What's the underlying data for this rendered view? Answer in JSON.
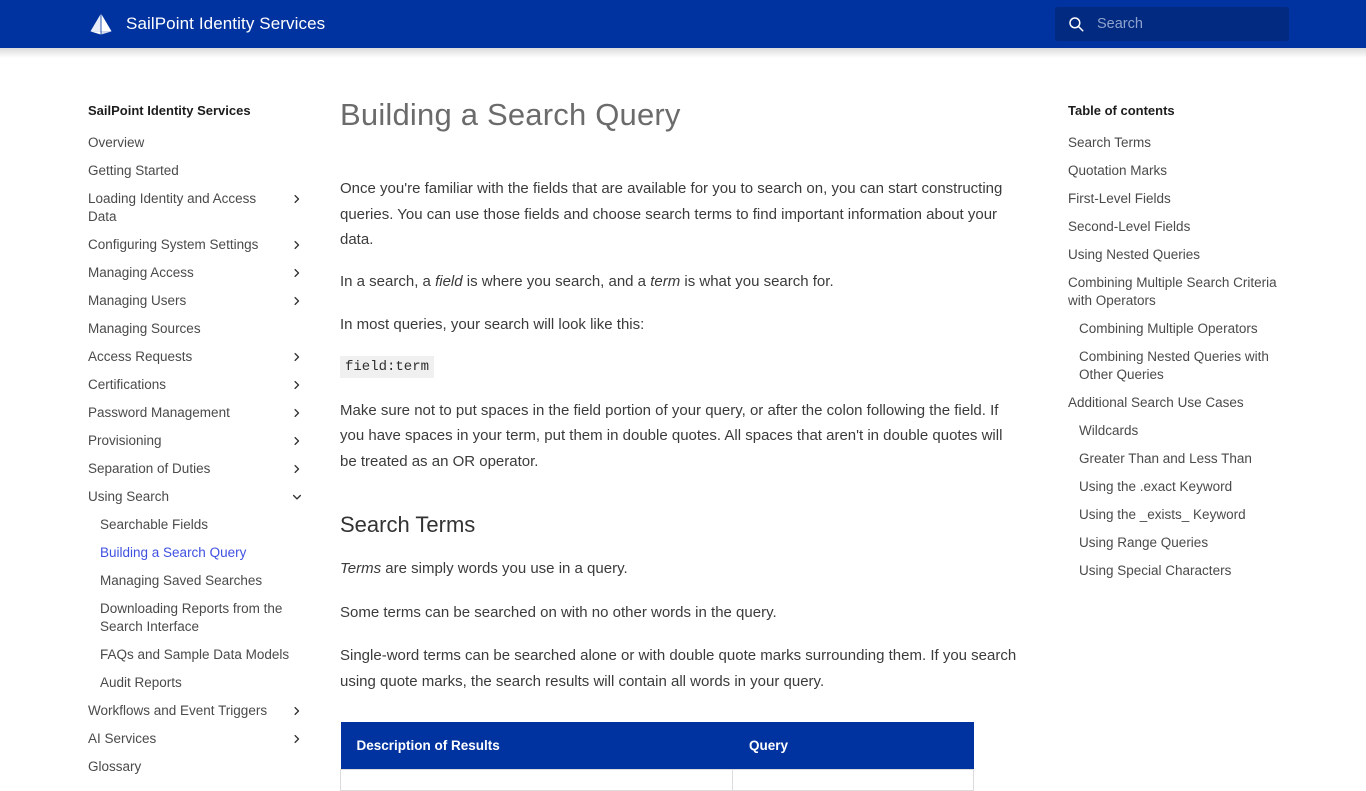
{
  "header": {
    "brand_title": "SailPoint Identity Services",
    "logo_icon": "sailpoint-sail-logo",
    "search": {
      "icon": "search-icon",
      "placeholder": "Search",
      "value": ""
    },
    "background_color": "#0033a0"
  },
  "sidebar": {
    "heading": "SailPoint Identity Services",
    "items": [
      {
        "label": "Overview",
        "level": 1,
        "chevron": "",
        "active": false
      },
      {
        "label": "Getting Started",
        "level": 1,
        "chevron": "",
        "active": false
      },
      {
        "label": "Loading Identity and Access Data",
        "level": 1,
        "chevron": "right",
        "active": false
      },
      {
        "label": "Configuring System Settings",
        "level": 1,
        "chevron": "right",
        "active": false
      },
      {
        "label": "Managing Access",
        "level": 1,
        "chevron": "right",
        "active": false
      },
      {
        "label": "Managing Users",
        "level": 1,
        "chevron": "right",
        "active": false
      },
      {
        "label": "Managing Sources",
        "level": 1,
        "chevron": "",
        "active": false
      },
      {
        "label": "Access Requests",
        "level": 1,
        "chevron": "right",
        "active": false
      },
      {
        "label": "Certifications",
        "level": 1,
        "chevron": "right",
        "active": false
      },
      {
        "label": "Password Management",
        "level": 1,
        "chevron": "right",
        "active": false
      },
      {
        "label": "Provisioning",
        "level": 1,
        "chevron": "right",
        "active": false
      },
      {
        "label": "Separation of Duties",
        "level": 1,
        "chevron": "right",
        "active": false
      },
      {
        "label": "Using Search",
        "level": 1,
        "chevron": "down",
        "active": false
      },
      {
        "label": "Searchable Fields",
        "level": 2,
        "chevron": "",
        "active": false
      },
      {
        "label": "Building a Search Query",
        "level": 2,
        "chevron": "",
        "active": true
      },
      {
        "label": "Managing Saved Searches",
        "level": 2,
        "chevron": "",
        "active": false
      },
      {
        "label": "Downloading Reports from the Search Interface",
        "level": 2,
        "chevron": "",
        "active": false
      },
      {
        "label": "FAQs and Sample Data Models",
        "level": 2,
        "chevron": "",
        "active": false
      },
      {
        "label": "Audit Reports",
        "level": 2,
        "chevron": "",
        "active": false
      },
      {
        "label": "Workflows and Event Triggers",
        "level": 1,
        "chevron": "right",
        "active": false
      },
      {
        "label": "AI Services",
        "level": 1,
        "chevron": "right",
        "active": false
      },
      {
        "label": "Glossary",
        "level": 1,
        "chevron": "",
        "active": false
      }
    ],
    "active_link_color": "#3f51e0"
  },
  "main": {
    "title": "Building a Search Query",
    "paragraph_1": "Once you're familiar with the fields that are available for you to search on, you can start constructing queries. You can use those fields and choose search terms to find important information about your data.",
    "paragraph_2_pre": "In a search, a ",
    "paragraph_2_em1": "field",
    "paragraph_2_mid": " is where you search, and a ",
    "paragraph_2_em2": "term",
    "paragraph_2_post": " is what you search for.",
    "paragraph_3": "In most queries, your search will look like this:",
    "code_example": "field:term",
    "paragraph_4": "Make sure not to put spaces in the field portion of your query, or after the colon following the field. If you have spaces in your term, put them in double quotes. All spaces that aren't in double quotes will be treated as an OR operator.",
    "section_search_terms": {
      "heading": "Search Terms",
      "paragraph_1_em": "Terms",
      "paragraph_1_post": " are simply words you use in a query.",
      "paragraph_2": "Some terms can be searched on with no other words in the query.",
      "paragraph_3": "Single-word terms can be searched alone or with double quote marks surrounding them. If you search using quote marks, the search results will contain all words in your query."
    },
    "table": {
      "header_background": "#0033a0",
      "columns": [
        "Description of Results",
        "Query"
      ],
      "rows": []
    }
  },
  "toc": {
    "heading": "Table of contents",
    "items": [
      {
        "label": "Search Terms",
        "level": 1
      },
      {
        "label": "Quotation Marks",
        "level": 1
      },
      {
        "label": "First-Level Fields",
        "level": 1
      },
      {
        "label": "Second-Level Fields",
        "level": 1
      },
      {
        "label": "Using Nested Queries",
        "level": 1
      },
      {
        "label": "Combining Multiple Search Criteria with Operators",
        "level": 1
      },
      {
        "label": "Combining Multiple Operators",
        "level": 2
      },
      {
        "label": "Combining Nested Queries with Other Queries",
        "level": 2
      },
      {
        "label": "Additional Search Use Cases",
        "level": 1
      },
      {
        "label": "Wildcards",
        "level": 2
      },
      {
        "label": "Greater Than and Less Than",
        "level": 2
      },
      {
        "label": "Using the .exact Keyword",
        "level": 2
      },
      {
        "label": "Using the _exists_ Keyword",
        "level": 2
      },
      {
        "label": "Using Range Queries",
        "level": 2
      },
      {
        "label": "Using Special Characters",
        "level": 2
      }
    ]
  }
}
